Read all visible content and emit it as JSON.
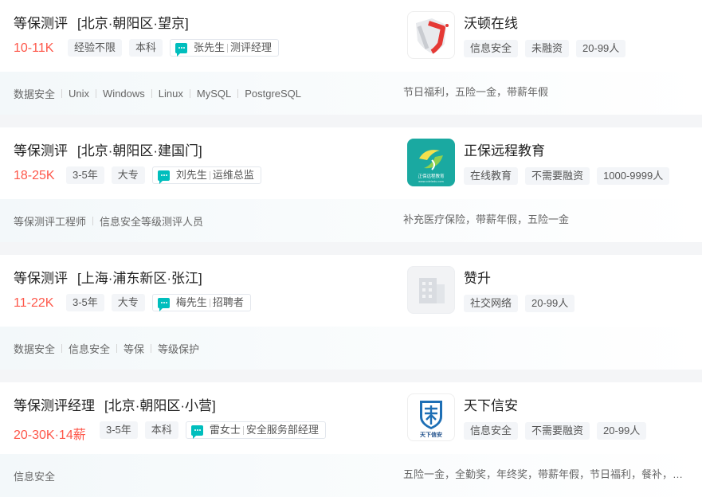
{
  "jobs": [
    {
      "title": "等保测评",
      "area": "[北京·朝阳区·望京]",
      "salary": "10-11K",
      "tags": [
        "经验不限",
        "本科"
      ],
      "recruiter_name": "张先生",
      "recruiter_title": "测评经理",
      "skills": [
        "数据安全",
        "Unix",
        "Windows",
        "Linux",
        "MySQL",
        "PostgreSQL"
      ],
      "welfare": "节日福利，五险一金，带薪年假",
      "company": "沃顿在线",
      "company_tags": [
        "信息安全",
        "未融资",
        "20-99人"
      ],
      "logo_icon": "woton-shield-logo"
    },
    {
      "title": "等保测评",
      "area": "[北京·朝阳区·建国门]",
      "salary": "18-25K",
      "tags": [
        "3-5年",
        "大专"
      ],
      "recruiter_name": "刘先生",
      "recruiter_title": "运维总监",
      "skills": [
        "等保测评工程师",
        "信息安全等级测评人员"
      ],
      "welfare": "补充医疗保险，带薪年假，五险一金",
      "company": "正保远程教育",
      "company_tags": [
        "在线教育",
        "不需要融资",
        "1000-9999人"
      ],
      "logo_icon": "cdeledu-logo",
      "logo_text": "正保远程教育",
      "logo_subtext": "www.cdeledu.com"
    },
    {
      "title": "等保测评",
      "area": "[上海·浦东新区·张江]",
      "salary": "11-22K",
      "tags": [
        "3-5年",
        "大专"
      ],
      "recruiter_name": "梅先生",
      "recruiter_title": "招聘者",
      "skills": [
        "数据安全",
        "信息安全",
        "等保",
        "等级保护"
      ],
      "welfare": "",
      "company": "赞升",
      "company_tags": [
        "社交网络",
        "20-99人"
      ],
      "logo_icon": "building-placeholder-icon"
    },
    {
      "title": "等保测评经理",
      "area": "[北京·朝阳区·小营]",
      "salary": "20-30K·14薪",
      "tags": [
        "3-5年",
        "本科"
      ],
      "recruiter_name": "雷女士",
      "recruiter_title": "安全服务部经理",
      "skills": [
        "信息安全"
      ],
      "welfare": "五险一金，全勤奖，年终奖，带薪年假，节日福利，餐补，…",
      "company": "天下信安",
      "company_tags": [
        "信息安全",
        "不需要融资",
        "20-99人"
      ],
      "logo_icon": "txxa-shield-logo",
      "logo_text": "天下信安"
    }
  ],
  "colors": {
    "salary": "#fe574a",
    "accent": "#00bebd"
  }
}
